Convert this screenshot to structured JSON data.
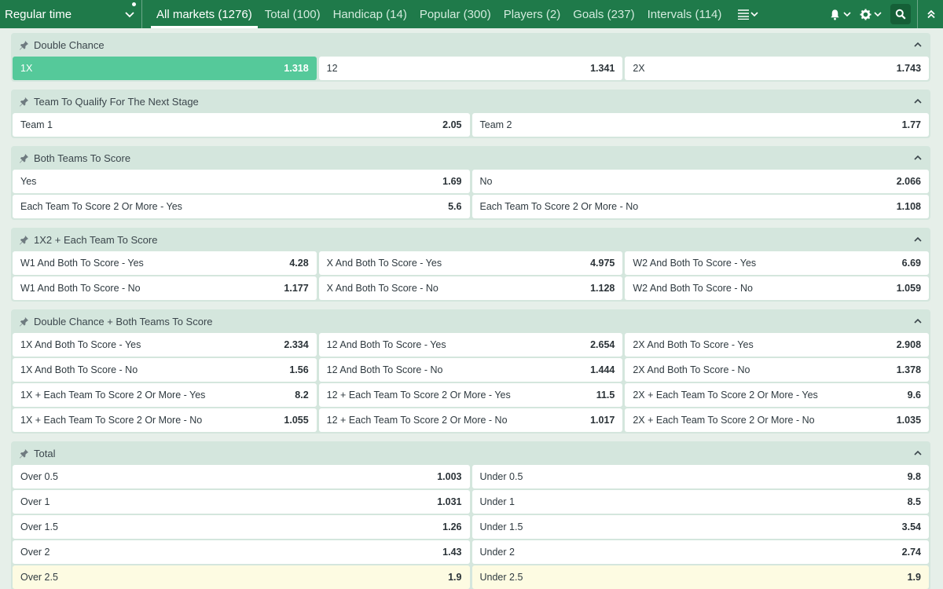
{
  "topbar": {
    "period_label": "Regular time",
    "tabs": [
      {
        "label": "All markets (1276)"
      },
      {
        "label": "Total (100)"
      },
      {
        "label": "Handicap (14)"
      },
      {
        "label": "Popular (300)"
      },
      {
        "label": "Players (2)"
      },
      {
        "label": "Goals (237)"
      },
      {
        "label": "Intervals (114)"
      }
    ],
    "icons": [
      "chevron-down-icon",
      "menu-lines-icon",
      "bell-icon",
      "gear-icon",
      "search-icon",
      "double-chevron-up-icon"
    ]
  },
  "colors": {
    "topbar": "#1f7a4a",
    "selected": "#55c99a",
    "highlight": "#fdfbe2",
    "group_bg": "#d4e6dd",
    "page_bg": "#e6efe9"
  },
  "markets": [
    {
      "title": "Double Chance",
      "rows": [
        [
          {
            "label": "1X",
            "odd": "1.318",
            "state": "selected"
          },
          {
            "label": "12",
            "odd": "1.341"
          },
          {
            "label": "2X",
            "odd": "1.743"
          }
        ]
      ]
    },
    {
      "title": "Team To Qualify For The Next Stage",
      "rows": [
        [
          {
            "label": "Team 1",
            "odd": "2.05"
          },
          {
            "label": "Team 2",
            "odd": "1.77"
          }
        ]
      ]
    },
    {
      "title": "Both Teams To Score",
      "rows": [
        [
          {
            "label": "Yes",
            "odd": "1.69"
          },
          {
            "label": "No",
            "odd": "2.066"
          }
        ],
        [
          {
            "label": "Each Team To Score 2 Or More - Yes",
            "odd": "5.6"
          },
          {
            "label": "Each Team To Score 2 Or More - No",
            "odd": "1.108"
          }
        ]
      ]
    },
    {
      "title": "1X2 + Each Team To Score",
      "rows": [
        [
          {
            "label": "W1 And Both To Score - Yes",
            "odd": "4.28"
          },
          {
            "label": "X And Both To Score - Yes",
            "odd": "4.975"
          },
          {
            "label": "W2 And Both To Score - Yes",
            "odd": "6.69"
          }
        ],
        [
          {
            "label": "W1 And Both To Score - No",
            "odd": "1.177"
          },
          {
            "label": "X And Both To Score - No",
            "odd": "1.128"
          },
          {
            "label": "W2 And Both To Score - No",
            "odd": "1.059"
          }
        ]
      ]
    },
    {
      "title": "Double Chance + Both Teams To Score",
      "rows": [
        [
          {
            "label": "1X And Both To Score - Yes",
            "odd": "2.334"
          },
          {
            "label": "12 And Both To Score - Yes",
            "odd": "2.654"
          },
          {
            "label": "2X And Both To Score - Yes",
            "odd": "2.908"
          }
        ],
        [
          {
            "label": "1X And Both To Score - No",
            "odd": "1.56"
          },
          {
            "label": "12 And Both To Score - No",
            "odd": "1.444"
          },
          {
            "label": "2X And Both To Score - No",
            "odd": "1.378"
          }
        ],
        [
          {
            "label": "1X + Each Team To Score 2 Or More - Yes",
            "odd": "8.2"
          },
          {
            "label": "12 + Each Team To Score 2 Or More - Yes",
            "odd": "11.5"
          },
          {
            "label": "2X + Each Team To Score 2 Or More - Yes",
            "odd": "9.6"
          }
        ],
        [
          {
            "label": "1X + Each Team To Score 2 Or More - No",
            "odd": "1.055"
          },
          {
            "label": "12 + Each Team To Score 2 Or More - No",
            "odd": "1.017"
          },
          {
            "label": "2X + Each Team To Score 2 Or More - No",
            "odd": "1.035"
          }
        ]
      ]
    },
    {
      "title": "Total",
      "rows": [
        [
          {
            "label": "Over 0.5",
            "odd": "1.003"
          },
          {
            "label": "Under 0.5",
            "odd": "9.8"
          }
        ],
        [
          {
            "label": "Over 1",
            "odd": "1.031"
          },
          {
            "label": "Under 1",
            "odd": "8.5"
          }
        ],
        [
          {
            "label": "Over 1.5",
            "odd": "1.26"
          },
          {
            "label": "Under 1.5",
            "odd": "3.54"
          }
        ],
        [
          {
            "label": "Over 2",
            "odd": "1.43"
          },
          {
            "label": "Under 2",
            "odd": "2.74"
          }
        ],
        [
          {
            "label": "Over 2.5",
            "odd": "1.9",
            "state": "highlight"
          },
          {
            "label": "Under 2.5",
            "odd": "1.9",
            "state": "highlight"
          }
        ]
      ]
    }
  ]
}
